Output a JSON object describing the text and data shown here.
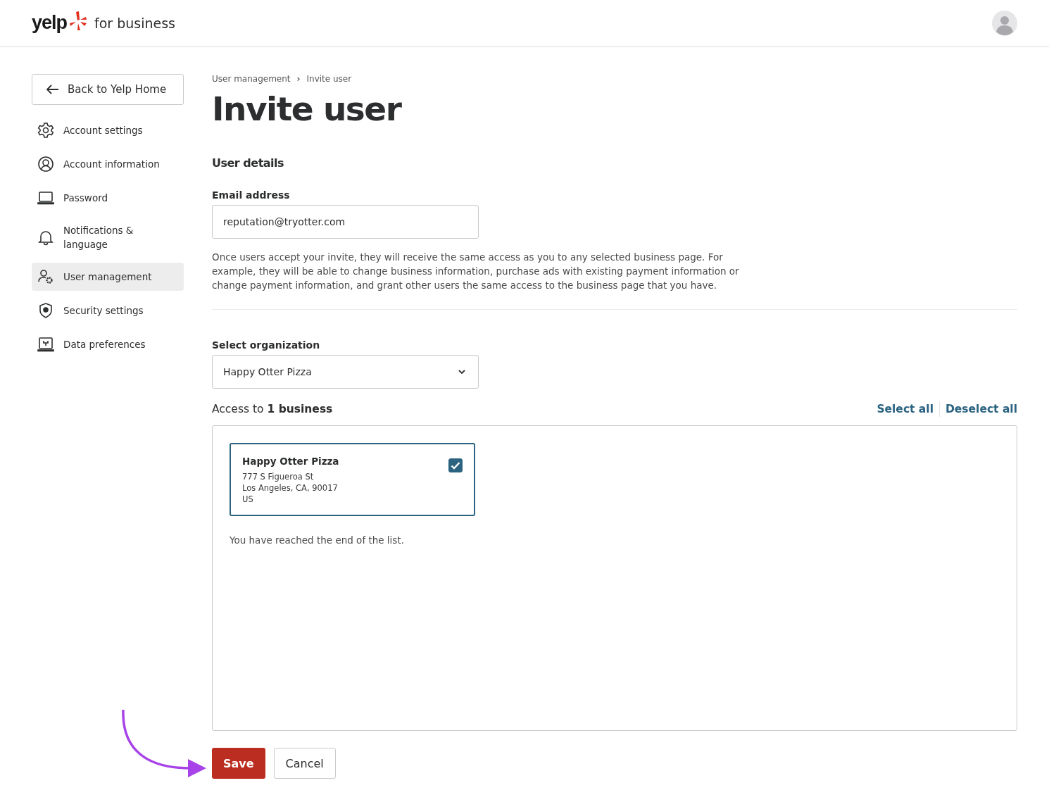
{
  "header": {
    "logo_text": "yelp",
    "logo_suffix": "for business"
  },
  "sidebar": {
    "back_button": "Back to Yelp Home",
    "items": [
      {
        "label": "Account settings",
        "kind": "gear",
        "selected": false
      },
      {
        "label": "Account information",
        "kind": "user",
        "selected": false
      },
      {
        "label": "Password",
        "kind": "laptop",
        "selected": false
      },
      {
        "label": "Notifications & language",
        "kind": "bell",
        "selected": false
      },
      {
        "label": "User management",
        "kind": "usergear",
        "selected": true
      },
      {
        "label": "Security settings",
        "kind": "shield",
        "selected": false
      },
      {
        "label": "Data preferences",
        "kind": "data",
        "selected": false
      }
    ]
  },
  "breadcrumb": [
    {
      "label": "User management"
    },
    {
      "label": "Invite user"
    }
  ],
  "breadcrumb_separator": "›",
  "title": "Invite user",
  "section_title": "User details",
  "email": {
    "label": "Email address",
    "value": "reputation@tryotter.com"
  },
  "notice": "Once users accept your invite, they will receive the same access as you to any selected business page. For example, they will be able to change business information, purchase ads with existing payment information or change payment information, and grant other users the same access to the business page that you have.",
  "organization": {
    "label": "Select organization",
    "value": "Happy Otter Pizza"
  },
  "access": {
    "summary": "Access to **1 business**",
    "select_all": "Select all",
    "deselect_all": "Deselect all"
  },
  "businesses": [
    {
      "name": "Happy Otter Pizza",
      "address_lines": [
        "777 S Figueroa St",
        "Los Angeles, CA, 90017",
        "US"
      ],
      "checked": true
    }
  ],
  "end_of_list": "You have reached the end of the list.",
  "buttons": {
    "save": "Save",
    "cancel": "Cancel"
  }
}
